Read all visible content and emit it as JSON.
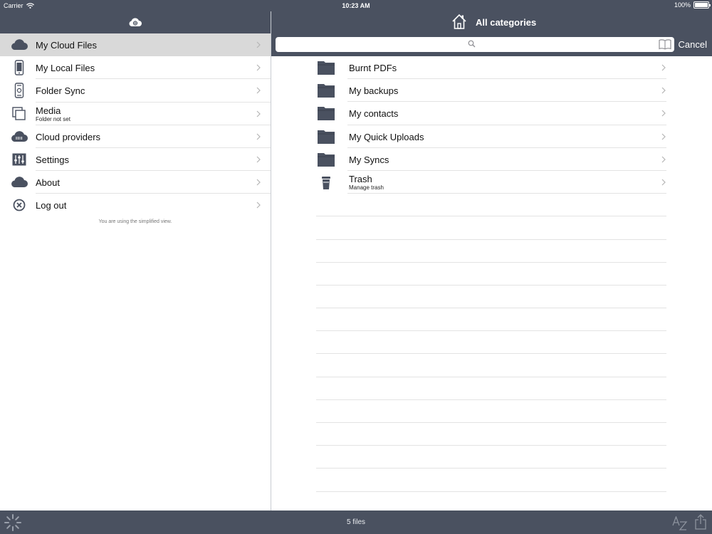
{
  "status": {
    "carrier": "Carrier",
    "time": "10:23 AM",
    "battery": "100%"
  },
  "sidebar": {
    "items": [
      {
        "label": "My Cloud Files",
        "sub": "",
        "icon": "cloud-icon",
        "selected": true
      },
      {
        "label": "My Local Files",
        "sub": "",
        "icon": "phone-icon",
        "selected": false
      },
      {
        "label": "Folder Sync",
        "sub": "",
        "icon": "folder-sync-icon",
        "selected": false
      },
      {
        "label": "Media",
        "sub": "Folder not set",
        "icon": "media-icon",
        "selected": false
      },
      {
        "label": "Cloud providers",
        "sub": "",
        "icon": "cloud-providers-icon",
        "selected": false
      },
      {
        "label": "Settings",
        "sub": "",
        "icon": "sliders-icon",
        "selected": false
      },
      {
        "label": "About",
        "sub": "",
        "icon": "cloud-icon",
        "selected": false
      },
      {
        "label": "Log out",
        "sub": "",
        "icon": "logout-icon",
        "selected": false
      }
    ],
    "note": "You are using the simplified view."
  },
  "header": {
    "title": "All categories",
    "cancel_label": "Cancel",
    "search_placeholder": ""
  },
  "files": [
    {
      "name": "Burnt PDFs",
      "sub": "",
      "icon": "folder-icon"
    },
    {
      "name": "My backups",
      "sub": "",
      "icon": "folder-icon"
    },
    {
      "name": "My contacts",
      "sub": "",
      "icon": "folder-icon"
    },
    {
      "name": "My Quick Uploads",
      "sub": "",
      "icon": "folder-icon"
    },
    {
      "name": "My Syncs",
      "sub": "",
      "icon": "folder-icon"
    },
    {
      "name": "Trash",
      "sub": "Manage trash",
      "icon": "trash-icon"
    }
  ],
  "toolbar": {
    "count": "5 files"
  },
  "colors": {
    "bar": "#4a5160",
    "selected_row": "#d9d9d9",
    "icon": "#4a5160"
  }
}
